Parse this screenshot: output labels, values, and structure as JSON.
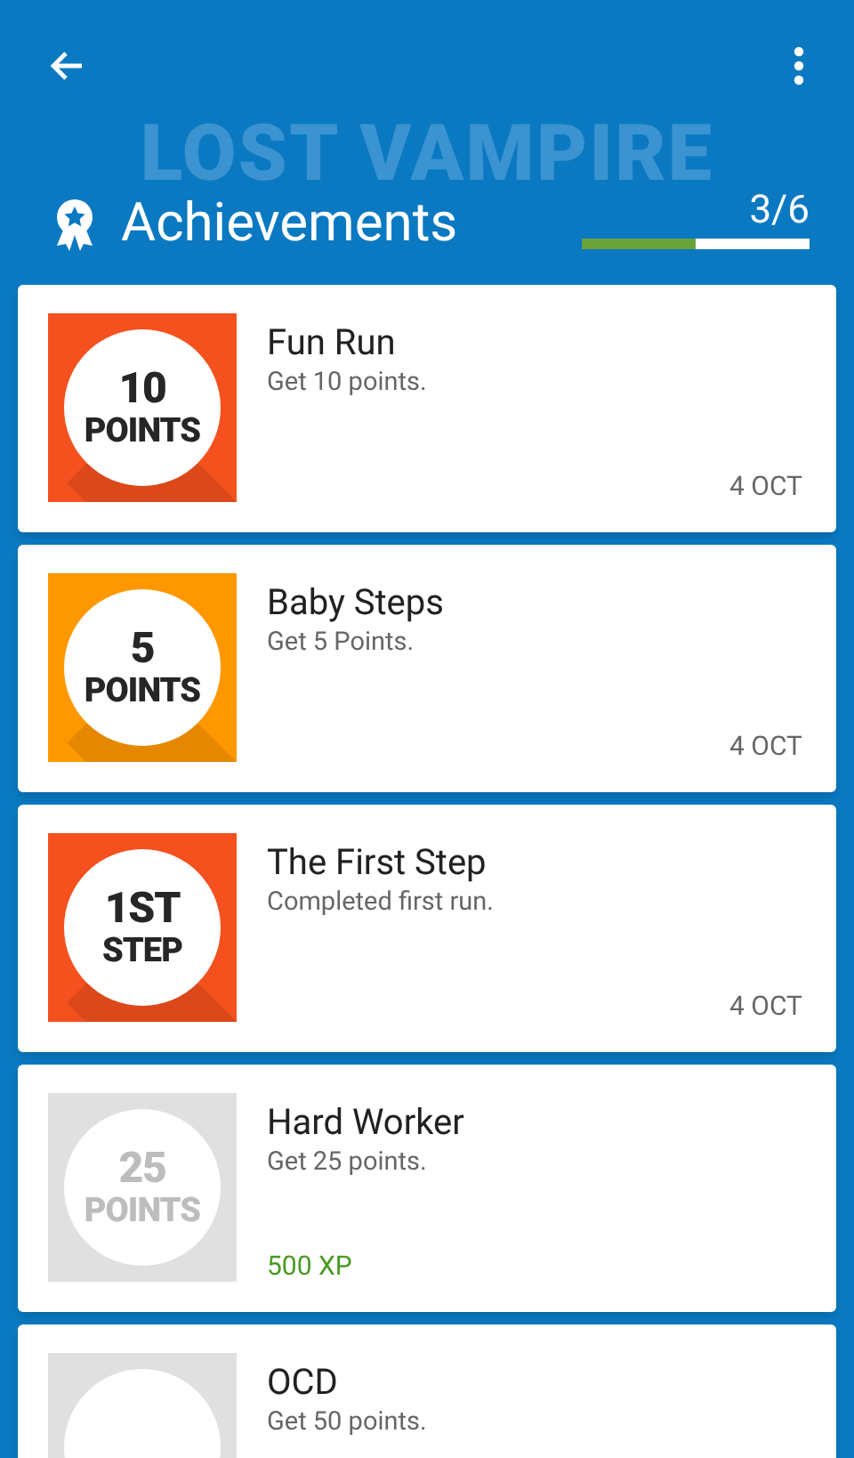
{
  "header": {
    "logo": "LOST VAMPIRE",
    "title": "Achievements",
    "progress": {
      "reading": "3/6",
      "level": 0.5
    }
  },
  "achievements": [
    {
      "badge": [
        "10",
        "POINTS"
      ],
      "color": "#f4511e",
      "unlocked": true,
      "title": "Fun Run",
      "description": "Get 10 points.",
      "date": "4 OCT"
    },
    {
      "badge": [
        "5",
        "POINTS"
      ],
      "color": "#ff9800",
      "unlocked": true,
      "title": "Baby Steps",
      "description": "Get 5 Points.",
      "date": "4 OCT"
    },
    {
      "badge": [
        "1ST",
        "STEP"
      ],
      "color": "#f4511e",
      "unlocked": true,
      "title": "The First Step",
      "description": "Completed first run.",
      "date": "4 OCT"
    },
    {
      "badge": [
        "25",
        "POINTS"
      ],
      "unlocked": false,
      "title": "Hard Worker",
      "description": "Get 25 points.",
      "reward": "500 XP"
    },
    {
      "unlocked": false,
      "title": "OCD",
      "description": "Get 50 points."
    }
  ]
}
